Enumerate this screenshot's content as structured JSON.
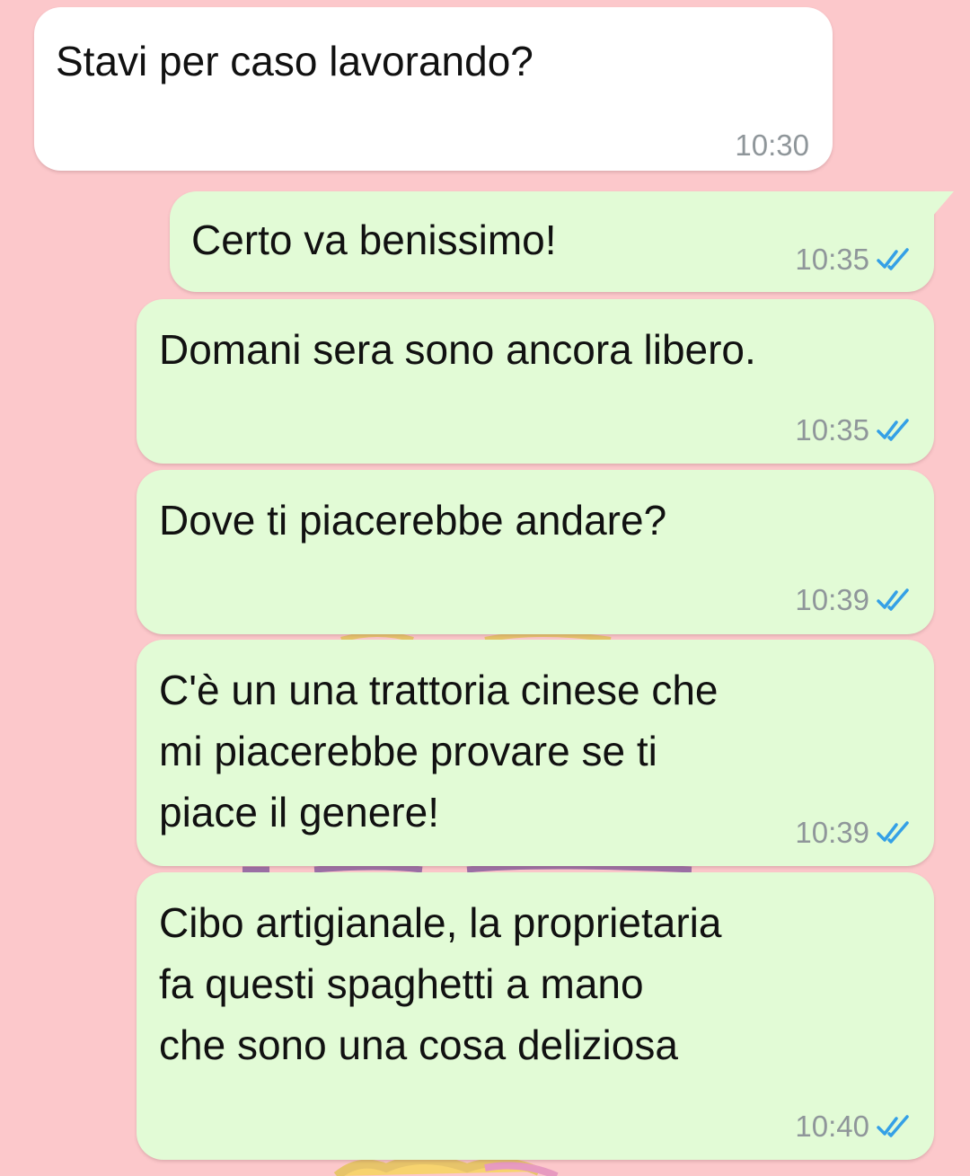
{
  "colors": {
    "wallpaper": "#fcc8cb",
    "incoming_bubble": "#ffffff",
    "outgoing_bubble": "#e2fbd6",
    "timestamp": "#8f969a",
    "read_ticks": "#34a0e6"
  },
  "messages": [
    {
      "direction": "incoming",
      "text": "Stavi per caso lavorando?",
      "time": "10:30"
    },
    {
      "direction": "outgoing",
      "text": "Certo va benissimo!",
      "time": "10:35",
      "status_icon": "double-check-read-icon"
    },
    {
      "direction": "outgoing",
      "text": "Domani sera sono ancora libero.",
      "time": "10:35",
      "status_icon": "double-check-read-icon"
    },
    {
      "direction": "outgoing",
      "text": "Dove ti piacerebbe andare?",
      "time": "10:39",
      "status_icon": "double-check-read-icon"
    },
    {
      "direction": "outgoing",
      "text": "C'è un una trattoria cinese che\nmi piacerebbe provare se ti\npiace il genere!",
      "time": "10:39",
      "status_icon": "double-check-read-icon"
    },
    {
      "direction": "outgoing",
      "text": "Cibo artigianale, la proprietaria\nfa questi spaghetti a mano\nche sono una cosa deliziosa",
      "time": "10:40",
      "status_icon": "double-check-read-icon"
    }
  ]
}
